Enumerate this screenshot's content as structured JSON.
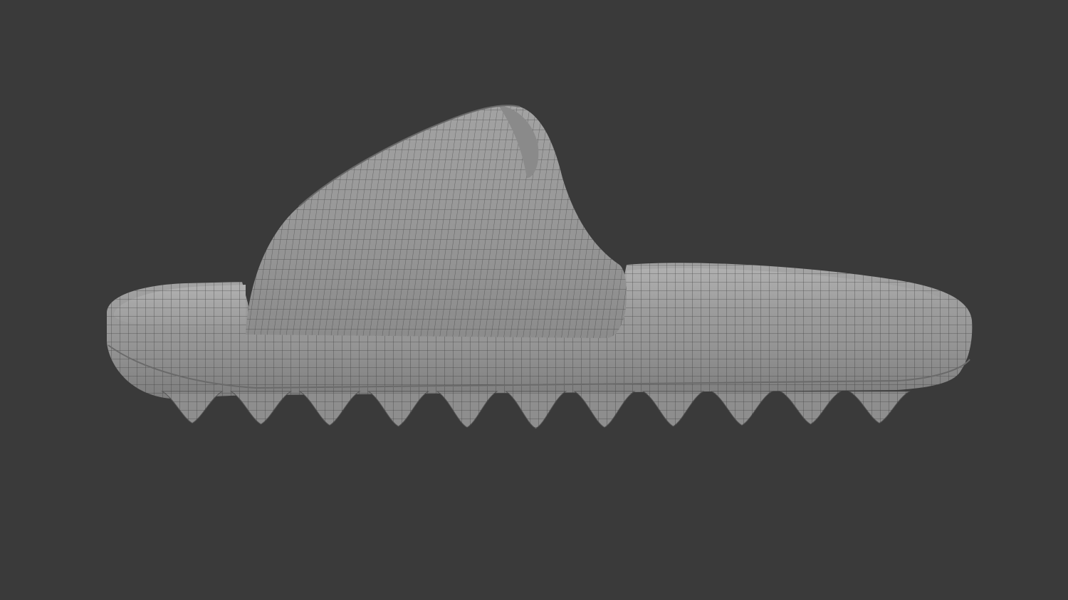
{
  "viewport": {
    "background_color": "#3a3a3a"
  },
  "model": {
    "subject": "slide-sandal",
    "display": "wireframe-on-shaded",
    "surface_color": "#9a9a9a",
    "wire_color": "#2e2e2e",
    "lug_count": 11
  }
}
